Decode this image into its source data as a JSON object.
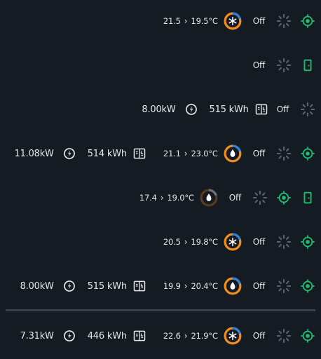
{
  "rows": [
    {
      "temp_from": "21.5",
      "temp_to": "19.5°C",
      "mode": "cool",
      "status": "Off",
      "indicator": "target"
    },
    {
      "status": "Off",
      "indicator": "door"
    },
    {
      "power": "8.00kW",
      "energy": "515 kWh",
      "status": "Off"
    },
    {
      "power": "11.08kW",
      "energy": "514 kWh",
      "temp_from": "21.1",
      "temp_to": "23.0°C",
      "mode": "heat",
      "status": "Off",
      "indicator": "target"
    },
    {
      "temp_from": "17.4",
      "temp_to": "19.0°C",
      "mode": "heat-dim",
      "status": "Off",
      "indicator": "target",
      "indicator2": "door"
    },
    {
      "temp_from": "20.5",
      "temp_to": "19.8°C",
      "mode": "cool",
      "status": "Off",
      "indicator": "target"
    },
    {
      "power": "8.00kW",
      "energy": "515 kWh",
      "temp_from": "19.9",
      "temp_to": "20.4°C",
      "mode": "heat",
      "status": "Off",
      "indicator": "target"
    },
    {
      "power": "7.31kW",
      "energy": "446 kWh",
      "temp_from": "22.6",
      "temp_to": "21.9°C",
      "mode": "cool",
      "status": "Off",
      "indicator": "target"
    }
  ],
  "colors": {
    "background": "#151b22",
    "text": "#e4e7ea",
    "green": "#1fbf73",
    "orange": "#f28c1d",
    "blue": "#2f7fe0",
    "spinner": "#5d646b"
  },
  "icons": {
    "cool": "snowflake-icon",
    "heat": "flame-icon",
    "power": "plug-icon",
    "energy": "meter-icon",
    "loading": "spinner-icon",
    "target": "target-icon",
    "door": "door-icon"
  }
}
